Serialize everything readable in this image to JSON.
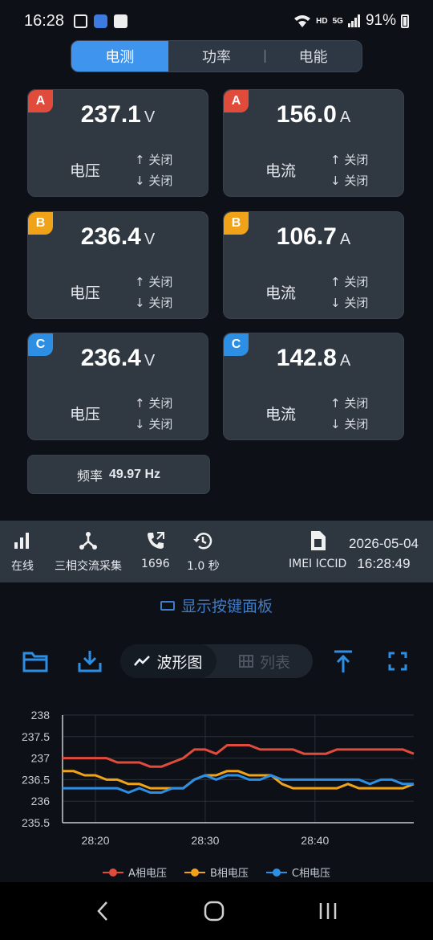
{
  "status_bar": {
    "time": "16:28",
    "network": "HD",
    "signal": "5G",
    "battery": "91%"
  },
  "tabs": [
    "电测",
    "功率",
    "电能"
  ],
  "cards": [
    {
      "phase": "A",
      "value": "237.1",
      "unit": "V",
      "label": "电压",
      "up": "↑ 关闭",
      "down": "↓ 关闭"
    },
    {
      "phase": "A",
      "value": "156.0",
      "unit": "A",
      "label": "电流",
      "up": "↑ 关闭",
      "down": "↓ 关闭"
    },
    {
      "phase": "B",
      "value": "236.4",
      "unit": "V",
      "label": "电压",
      "up": "↑ 关闭",
      "down": "↓ 关闭"
    },
    {
      "phase": "B",
      "value": "106.7",
      "unit": "A",
      "label": "电流",
      "up": "↑ 关闭",
      "down": "↓ 关闭"
    },
    {
      "phase": "C",
      "value": "236.4",
      "unit": "V",
      "label": "电压",
      "up": "↑ 关闭",
      "down": "↓ 关闭"
    },
    {
      "phase": "C",
      "value": "142.8",
      "unit": "A",
      "label": "电流",
      "up": "↑ 关闭",
      "down": "↓ 关闭"
    }
  ],
  "frequency": {
    "label": "频率",
    "value": "49.97 Hz"
  },
  "info": {
    "online": "在线",
    "mode": "三相交流采集",
    "count": "1696",
    "interval": "1.0 秒",
    "imei": "IMEI ICCID",
    "date": "2026-05-04",
    "time": "16:28:49"
  },
  "keyboard_link": "显示按键面板",
  "view_toggle": {
    "waveform": "波形图",
    "list": "列表"
  },
  "icons": [
    "folder-icon",
    "download-icon",
    "waveform-icon",
    "grid-icon",
    "upload-icon",
    "fullscreen-icon"
  ],
  "colors": {
    "accent": "#3f94ee",
    "phase_a": "#e04b3c",
    "phase_b": "#f0a219",
    "phase_c": "#2d8fe4"
  },
  "chart_data": {
    "type": "line",
    "x": [
      "28:17",
      "28:18",
      "28:19",
      "28:20",
      "28:21",
      "28:22",
      "28:23",
      "28:24",
      "28:25",
      "28:26",
      "28:27",
      "28:28",
      "28:29",
      "28:30",
      "28:31",
      "28:32",
      "28:33",
      "28:34",
      "28:35",
      "28:36",
      "28:37",
      "28:38",
      "28:39",
      "28:40",
      "28:41",
      "28:42",
      "28:43",
      "28:44",
      "28:45",
      "28:46",
      "28:47",
      "28:48",
      "28:49"
    ],
    "xticks": [
      "28:20",
      "28:30",
      "28:40"
    ],
    "yticks": [
      "238",
      "237.5",
      "237",
      "236.5",
      "236",
      "235.5"
    ],
    "ylim": [
      235.5,
      238
    ],
    "grid": true,
    "legend_position": "bottom",
    "series": [
      {
        "name": "A相电压",
        "color": "#e04b3c",
        "values": [
          237.0,
          237.0,
          237.0,
          237.0,
          237.0,
          236.9,
          236.9,
          236.9,
          236.8,
          236.8,
          236.9,
          237.0,
          237.2,
          237.2,
          237.1,
          237.3,
          237.3,
          237.3,
          237.2,
          237.2,
          237.2,
          237.2,
          237.1,
          237.1,
          237.1,
          237.2,
          237.2,
          237.2,
          237.2,
          237.2,
          237.2,
          237.2,
          237.1
        ]
      },
      {
        "name": "B相电压",
        "color": "#f0a219",
        "values": [
          236.7,
          236.7,
          236.6,
          236.6,
          236.5,
          236.5,
          236.4,
          236.4,
          236.3,
          236.3,
          236.3,
          236.3,
          236.5,
          236.6,
          236.6,
          236.7,
          236.7,
          236.6,
          236.6,
          236.6,
          236.4,
          236.3,
          236.3,
          236.3,
          236.3,
          236.3,
          236.4,
          236.3,
          236.3,
          236.3,
          236.3,
          236.3,
          236.4
        ]
      },
      {
        "name": "C相电压",
        "color": "#2d8fe4",
        "values": [
          236.3,
          236.3,
          236.3,
          236.3,
          236.3,
          236.3,
          236.2,
          236.3,
          236.2,
          236.2,
          236.3,
          236.3,
          236.5,
          236.6,
          236.5,
          236.6,
          236.6,
          236.5,
          236.5,
          236.6,
          236.5,
          236.5,
          236.5,
          236.5,
          236.5,
          236.5,
          236.5,
          236.5,
          236.4,
          236.5,
          236.5,
          236.4,
          236.4
        ]
      }
    ]
  }
}
